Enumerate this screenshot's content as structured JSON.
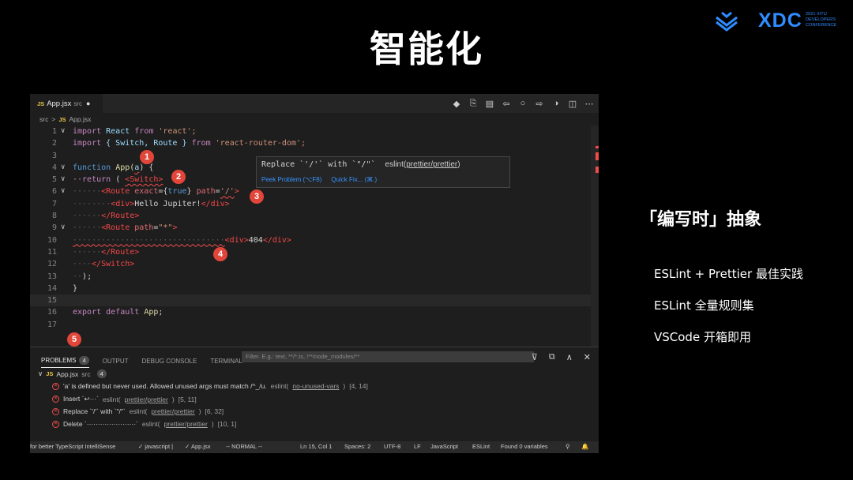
{
  "slide": {
    "title": "智能化",
    "logo": {
      "brand": "XDC",
      "sub": [
        "2021 XITU",
        "DEVELOPERS",
        "CONFERENCE"
      ]
    },
    "side": {
      "heading": "「编写时」抽象",
      "items": [
        "ESLint + Prettier 最佳实践",
        "ESLint 全量规则集",
        "VSCode 开箱即用"
      ]
    }
  },
  "editor": {
    "tab": {
      "lang": "JS",
      "file": "App.jsx",
      "dir": "src",
      "dirty": "●"
    },
    "tab_actions": [
      "◆",
      "⎘",
      "▤",
      "⇦",
      "○",
      "⇨",
      "◑",
      "◫",
      "⋯"
    ],
    "breadcrumb": [
      "src",
      ">",
      "JS",
      "App.jsx"
    ],
    "lines": [
      {
        "n": "1",
        "fold": "∨"
      },
      {
        "n": "2",
        "fold": ""
      },
      {
        "n": "3",
        "fold": ""
      },
      {
        "n": "4",
        "fold": "∨"
      },
      {
        "n": "5",
        "fold": "∨"
      },
      {
        "n": "6",
        "fold": "∨"
      },
      {
        "n": "7",
        "fold": ""
      },
      {
        "n": "8",
        "fold": ""
      },
      {
        "n": "9",
        "fold": "∨"
      },
      {
        "n": "10",
        "fold": ""
      },
      {
        "n": "11",
        "fold": ""
      },
      {
        "n": "12",
        "fold": ""
      },
      {
        "n": "13",
        "fold": ""
      },
      {
        "n": "14",
        "fold": ""
      },
      {
        "n": "15",
        "fold": ""
      },
      {
        "n": "16",
        "fold": ""
      },
      {
        "n": "17",
        "fold": ""
      }
    ],
    "code": {
      "l1": [
        "import",
        " React ",
        "from",
        " 'react';"
      ],
      "l2": [
        "import",
        " { Switch, Route } ",
        "from",
        " 'react-router-dom';"
      ],
      "l4": [
        "function",
        " App(",
        "a",
        ") {"
      ],
      "l5": [
        "··return",
        " ( ",
        "<Switch>"
      ],
      "l6": [
        "······",
        "<Route",
        " exact",
        "={",
        "true",
        "} ",
        "path",
        "=",
        "'/'",
        ">"
      ],
      "l7": [
        "········",
        "<div>",
        "Hello Jupiter!",
        "</div>"
      ],
      "l8": [
        "······",
        "</Route>"
      ],
      "l9": [
        "······",
        "<Route",
        " path",
        "=",
        "\"*\"",
        ">"
      ],
      "l10": [
        "································",
        "<div>",
        "404",
        "</div>"
      ],
      "l11": [
        "······",
        "</Route>"
      ],
      "l12": [
        "····",
        "</Switch>"
      ],
      "l13": [
        "··",
        ");"
      ],
      "l14": [
        "}"
      ],
      "l16": [
        "export",
        " default ",
        "App",
        ";"
      ]
    },
    "hover": {
      "message": "Replace `'/'` with `\"/\"`",
      "source": "eslint(",
      "rule": "prettier/prettier",
      "close": ")",
      "links": [
        "Peek Problem (⌥F8)",
        "Quick Fix... (⌘.)"
      ]
    },
    "badges": [
      "1",
      "2",
      "3",
      "4",
      "5"
    ]
  },
  "panel": {
    "tabs": [
      "PROBLEMS",
      "OUTPUT",
      "DEBUG CONSOLE",
      "TERMINAL"
    ],
    "problem_count": "4",
    "filter_placeholder": "Filter. E.g.: text, **/*.ts, !**/node_modules/**",
    "actions": [
      "⊽",
      "⧉",
      "∧",
      "✕"
    ],
    "file_group": {
      "lang": "JS",
      "file": "App.jsx",
      "dir": "src",
      "count": "4"
    },
    "problems": [
      {
        "msg": "'a' is defined but never used. Allowed unused args must match /^_/u.",
        "src": "eslint(",
        "rule": "no-unused-vars",
        "close": ")",
        "loc": "[4, 14]"
      },
      {
        "msg": "Insert `↩···`",
        "src": "eslint(",
        "rule": "prettier/prettier",
        "close": ")",
        "loc": "[5, 11]"
      },
      {
        "msg": "Replace `'/'` with `\"/\"`",
        "src": "eslint(",
        "rule": "prettier/prettier",
        "close": ")",
        "loc": "[6, 32]"
      },
      {
        "msg": "Delete `······················`",
        "src": "eslint(",
        "rule": "prettier/prettier",
        "close": ")",
        "loc": "[10, 1]"
      }
    ]
  },
  "statusbar": {
    "items": [
      "for better TypeScript IntelliSense",
      "✓ javascript |",
      "✓ App.jsx",
      "-- NORMAL --",
      "Ln 15, Col 1",
      "Spaces: 2",
      "UTF-8",
      "LF",
      "JavaScript",
      "ESLint",
      "Found 0 variables",
      "⚲",
      "🔔"
    ]
  },
  "colors": {
    "accent": "#2f8dff",
    "error": "#f14c4c",
    "badge": "#e2463a"
  }
}
